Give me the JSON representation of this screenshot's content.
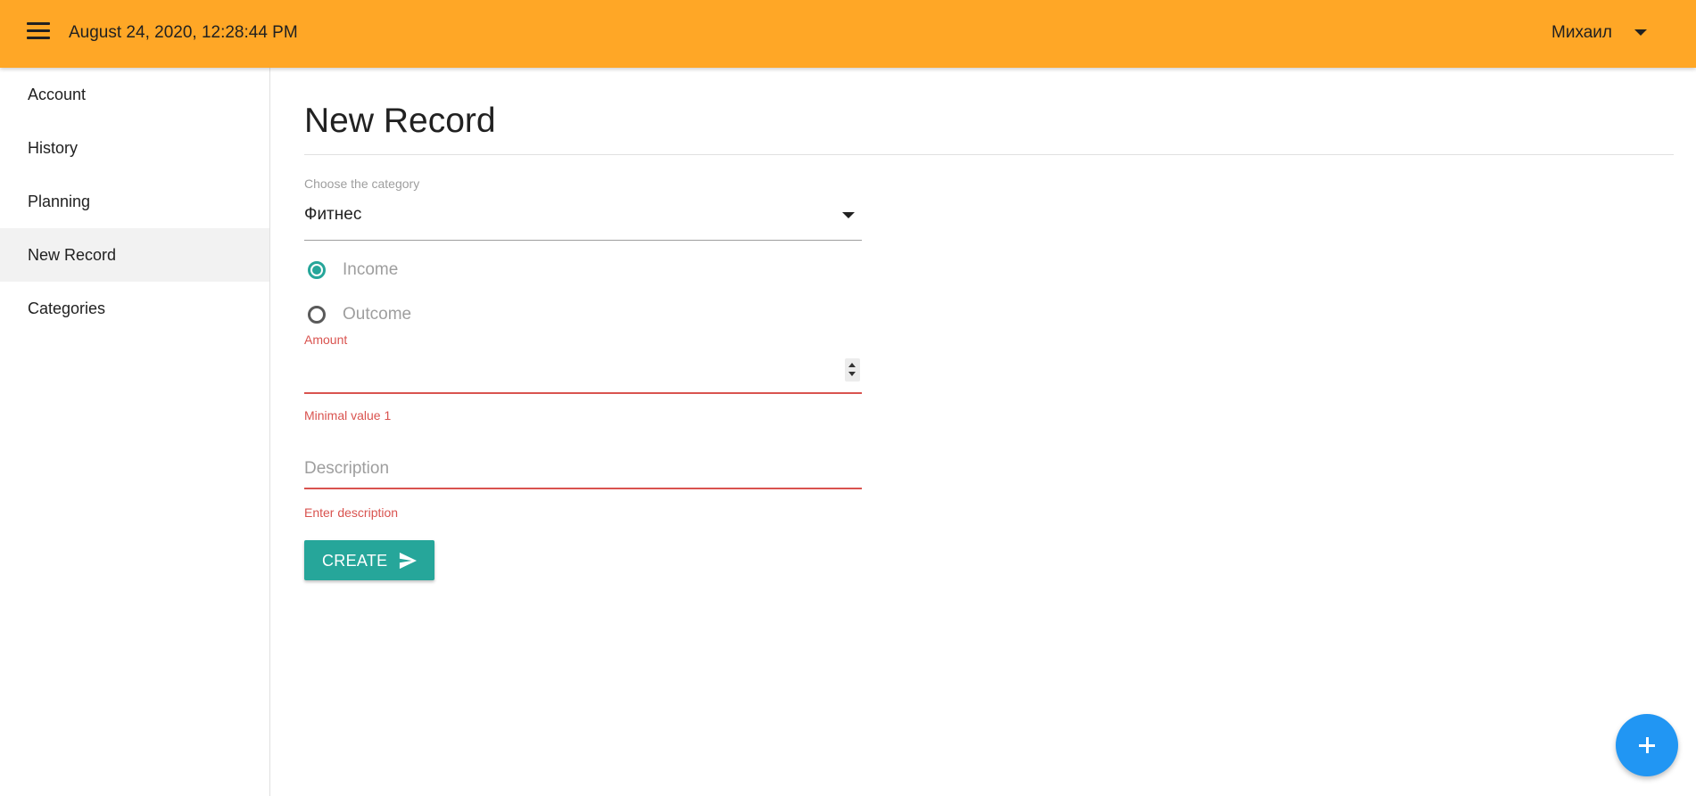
{
  "header": {
    "datetime": "August 24, 2020, 12:28:44 PM",
    "user_name": "Михаил",
    "menu_icon": "hamburger-menu-icon",
    "user_menu_icon": "caret-down-icon"
  },
  "sidebar": {
    "items": [
      {
        "label": "Account"
      },
      {
        "label": "History"
      },
      {
        "label": "Planning"
      },
      {
        "label": "New Record",
        "active": true
      },
      {
        "label": "Categories"
      }
    ]
  },
  "main": {
    "title": "New Record",
    "category": {
      "label": "Choose the category",
      "value": "Фитнес"
    },
    "type": {
      "options": [
        {
          "label": "Income",
          "checked": true
        },
        {
          "label": "Outcome",
          "checked": false
        }
      ]
    },
    "amount": {
      "label": "Amount",
      "value": "",
      "error": "Minimal value 1"
    },
    "description": {
      "placeholder": "Description",
      "value": "",
      "error": "Enter description"
    },
    "create_button": {
      "label": "CREATE",
      "icon": "send-icon"
    },
    "fab_icon": "plus-icon"
  },
  "colors": {
    "header": "#ffa726",
    "accent": "#26a69a",
    "error": "#d9534f",
    "fab": "#2196f3"
  }
}
